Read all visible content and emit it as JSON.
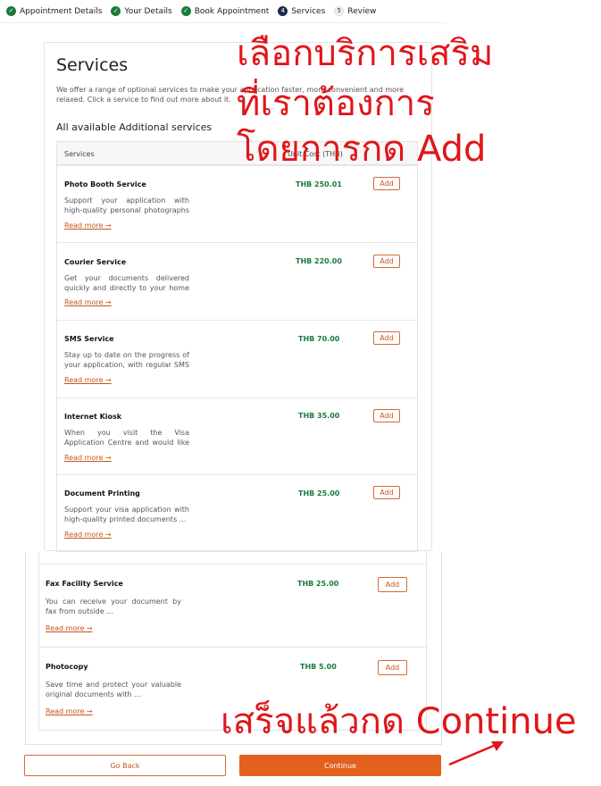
{
  "stepper": {
    "steps": [
      {
        "label": "Appointment Details",
        "state": "done"
      },
      {
        "label": "Your Details",
        "state": "done"
      },
      {
        "label": "Book Appointment",
        "state": "done"
      },
      {
        "label": "Services",
        "state": "current",
        "number": "4"
      },
      {
        "label": "Review",
        "state": "todo",
        "number": "5"
      }
    ]
  },
  "page": {
    "title": "Services",
    "description": "We offer a range of optional services to make your application faster, more convenient and more relaxed. Click a service to find out more about it.",
    "subtitle": "All available Additional services"
  },
  "table": {
    "col_services": "Services",
    "col_cost": "Unit Cost (THB)",
    "rows": [
      {
        "name": "Photo Booth Service",
        "desc": "Support your application with high-quality personal photographs ...",
        "price": "THB 250.01",
        "add": "Add",
        "read_more": "Read more →"
      },
      {
        "name": "Courier Service",
        "desc": "Get your documents delivered quickly and directly to your home ...",
        "price": "THB 220.00",
        "add": "Add",
        "read_more": "Read more →"
      },
      {
        "name": "SMS Service",
        "desc": "Stay up to date on the progress of your application, with regular SMS ...",
        "price": "THB 70.00",
        "add": "Add",
        "read_more": "Read more →"
      },
      {
        "name": "Internet Kiosk",
        "desc": "When you visit the Visa Application Centre and would like to access ...",
        "price": "THB 35.00",
        "add": "Add",
        "read_more": "Read more →"
      },
      {
        "name": "Document Printing",
        "desc": "Support your visa application with high-quality printed documents ...",
        "price": "THB 25.00",
        "add": "Add",
        "read_more": "Read more →"
      },
      {
        "name": "Fax Facility Service",
        "desc": "You can receive your document by fax from outside ...",
        "price": "THB 25.00",
        "add": "Add",
        "read_more": "Read more →"
      },
      {
        "name": "Photocopy",
        "desc": "Save time and protect your valuable original documents with ...",
        "price": "THB 5.00",
        "add": "Add",
        "read_more": "Read more →"
      }
    ]
  },
  "footer": {
    "back_label": "Go Back",
    "continue_label": "Continue"
  },
  "annotations": {
    "line1": "เลือกบริการเสริม",
    "line2": "ที่เราต้องการ",
    "line3": "โดยการกด Add",
    "continue_note": "เสร็จแล้วกด Continue",
    "color": "#e0161a"
  },
  "colors": {
    "accent": "#e4601f",
    "price_green": "#1b7a3a",
    "step_done": "#1b7a3a",
    "step_current": "#1a2b4d"
  }
}
